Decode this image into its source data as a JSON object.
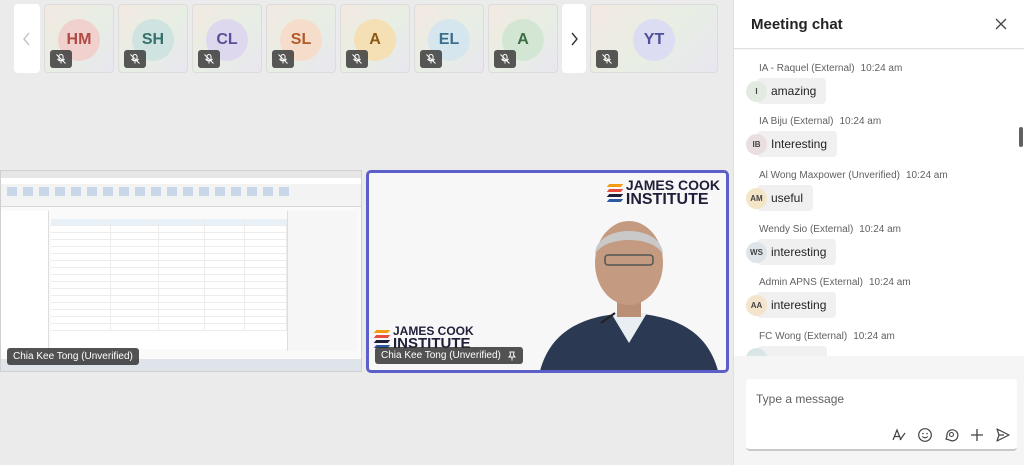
{
  "participants": [
    {
      "initials": "HM",
      "bg": "#f1d1cd",
      "fg": "#b14a43"
    },
    {
      "initials": "SH",
      "bg": "#cfe3e1",
      "fg": "#35706a"
    },
    {
      "initials": "CL",
      "bg": "#ddd8ee",
      "fg": "#5c4f99"
    },
    {
      "initials": "SL",
      "bg": "#f6dccb",
      "fg": "#b05c29"
    },
    {
      "initials": "A",
      "bg": "#f5e0b5",
      "fg": "#8a5a10"
    },
    {
      "initials": "EL",
      "bg": "#d6e6ee",
      "fg": "#3c6f8d"
    },
    {
      "initials": "A",
      "bg": "#d3e6d4",
      "fg": "#3d6e44"
    },
    {
      "initials": "YT",
      "bg": "#dcdcf2",
      "fg": "#4f4f99"
    }
  ],
  "video_left": {
    "name": "Chia Kee Tong (Unverified)"
  },
  "video_right": {
    "name": "Chia Kee Tong (Unverified)",
    "logo_line1": "JAMES COOK",
    "logo_line2": "INSTITUTE"
  },
  "chat": {
    "title": "Meeting chat",
    "messages": [
      {
        "sender": "IA - Raquel (External)",
        "time": "10:24 am",
        "initials": "I",
        "text": "amazing",
        "av_bg": "#e2ebdf"
      },
      {
        "sender": "IA Biju (External)",
        "time": "10:24 am",
        "initials": "IB",
        "text": "Interesting",
        "av_bg": "#eadfe0"
      },
      {
        "sender": "Al Wong Maxpower (Unverified)",
        "time": "10:24 am",
        "initials": "AM",
        "text": "useful",
        "av_bg": "#f3e6c7"
      },
      {
        "sender": "Wendy Sio (External)",
        "time": "10:24 am",
        "initials": "WS",
        "text": "interesting",
        "av_bg": "#dde5ea"
      },
      {
        "sender": "Admin APNS (External)",
        "time": "10:24 am",
        "initials": "AA",
        "text": "interesting",
        "av_bg": "#f4e4cd"
      },
      {
        "sender": "FC Wong (External)",
        "time": "10:24 am",
        "initials": "",
        "text": "",
        "av_bg": "#d9e6e8"
      }
    ],
    "composer_placeholder": "Type a message"
  },
  "colors": {
    "accent": "#5b5fc7"
  }
}
